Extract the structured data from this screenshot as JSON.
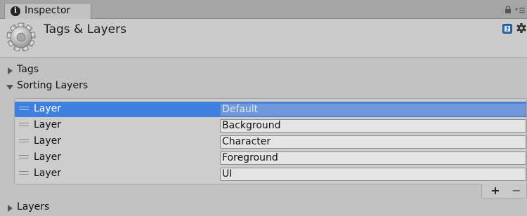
{
  "tab": {
    "label": "Inspector",
    "info_glyph": "i"
  },
  "header": {
    "title": "Tags & Layers"
  },
  "foldouts": {
    "tags": {
      "label": "Tags",
      "expanded": false
    },
    "sorting_layers": {
      "label": "Sorting Layers",
      "expanded": true
    },
    "layers": {
      "label": "Layers",
      "expanded": false
    }
  },
  "sorting_layers": [
    {
      "label": "Layer",
      "name": "Default",
      "selected": true
    },
    {
      "label": "Layer",
      "name": "Background",
      "selected": false
    },
    {
      "label": "Layer",
      "name": "Character",
      "selected": false
    },
    {
      "label": "Layer",
      "name": "Foreground",
      "selected": false
    },
    {
      "label": "Layer",
      "name": "UI",
      "selected": false
    }
  ],
  "list_footer": {
    "add_label": "+",
    "remove_label": "−"
  },
  "colors": {
    "selection": "#3d80df",
    "panel": "#c2c2c2",
    "help_icon": "#2b6bb5"
  }
}
